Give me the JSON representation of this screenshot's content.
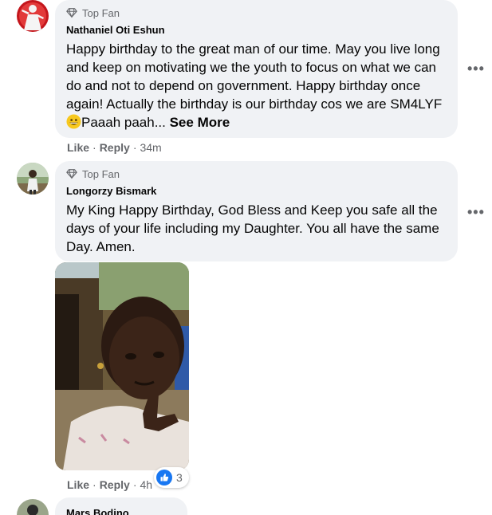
{
  "comments": [
    {
      "badge": "Top Fan",
      "author": "Nathaniel Oti Eshun",
      "text_before_emoji": "Happy birthday to the great man of our time. May you live long and keep on motivating we the youth to focus on what we can do and not to depend on government. Happy birthday once again! Actually the birthday is our birthday cos we are SM4LYF",
      "text_after_emoji": "Paaah paah... ",
      "see_more": "See More",
      "like": "Like",
      "separator": "·",
      "reply": "Reply",
      "time": "34m"
    },
    {
      "badge": "Top Fan",
      "author": "Longorzy Bismark",
      "text": "My King Happy Birthday, God Bless and Keep you safe all the days of your life including my Daughter. You all have the same Day. Amen.",
      "like": "Like",
      "separator": "·",
      "reply": "Reply",
      "time": "4h",
      "reaction_count": "3"
    },
    {
      "author": "Mars Bodino"
    }
  ],
  "more_options": "•••",
  "colors": {
    "bubble": "#f0f2f5",
    "secondary_text": "#65676b",
    "like_blue": "#1877f2"
  }
}
